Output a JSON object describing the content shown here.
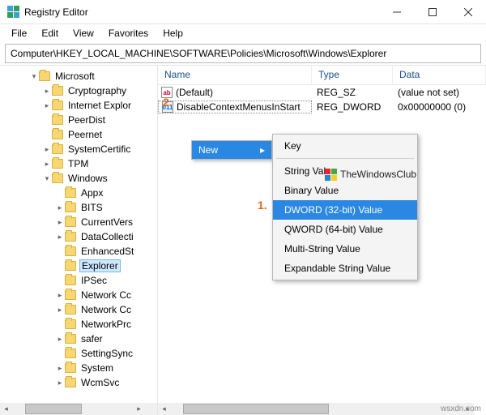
{
  "window": {
    "title": "Registry Editor"
  },
  "menu": {
    "file": "File",
    "edit": "Edit",
    "view": "View",
    "favorites": "Favorites",
    "help": "Help"
  },
  "address": "Computer\\HKEY_LOCAL_MACHINE\\SOFTWARE\\Policies\\Microsoft\\Windows\\Explorer",
  "tree": {
    "microsoft": "Microsoft",
    "children_ms": [
      "Cryptography",
      "Internet Explor",
      "PeerDist",
      "Peernet",
      "SystemCertific",
      "TPM"
    ],
    "windows": "Windows",
    "children_win": [
      "Appx",
      "BITS",
      "CurrentVers",
      "DataCollecti",
      "EnhancedSt",
      "Explorer",
      "IPSec",
      "Network Cc",
      "Network Cc",
      "NetworkPrc",
      "safer",
      "SettingSync",
      "System",
      "WcmSvc"
    ],
    "selected": "Explorer"
  },
  "list": {
    "cols": {
      "name": "Name",
      "type": "Type",
      "data": "Data"
    },
    "rows": [
      {
        "icon": "ab",
        "name": "(Default)",
        "type": "REG_SZ",
        "data": "(value not set)"
      },
      {
        "icon": "011",
        "name": "DisableContextMenusInStart",
        "type": "REG_DWORD",
        "data": "0x00000000 (0)"
      }
    ]
  },
  "annot": {
    "one": "1.",
    "two": "2."
  },
  "ctx": {
    "new": "New",
    "items": [
      "Key",
      "String Value",
      "Binary Value",
      "DWORD (32-bit) Value",
      "QWORD (64-bit) Value",
      "Multi-String Value",
      "Expandable String Value"
    ],
    "hl": "DWORD (32-bit) Value"
  },
  "watermark": "TheWindowsClub",
  "credit": "wsxdn.com"
}
